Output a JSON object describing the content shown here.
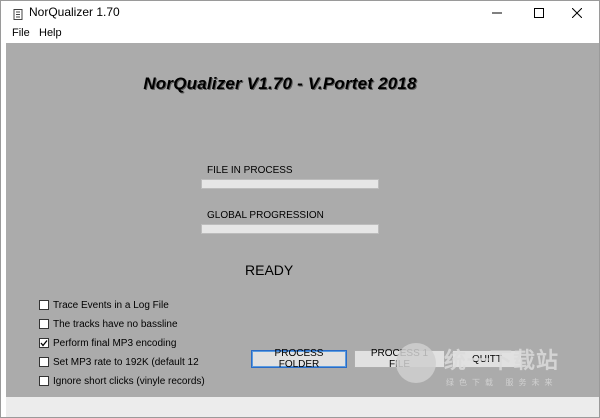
{
  "window": {
    "title": "NorQualizer 1.70"
  },
  "menu": {
    "file": "File",
    "help": "Help"
  },
  "main": {
    "heading": "NorQualizer V1.70 - V.Portet 2018",
    "file_in_process_label": "FILE IN PROCESS",
    "file_progress": 0,
    "global_progression_label": "GLOBAL PROGRESSION",
    "global_progress": 0,
    "status": "READY"
  },
  "options": [
    {
      "label": "Trace Events in a Log File",
      "checked": false
    },
    {
      "label": "The tracks have no bassline",
      "checked": false
    },
    {
      "label": "Perform final MP3 encoding",
      "checked": true
    },
    {
      "label": "Set MP3 rate to 192K (default 12",
      "checked": false
    },
    {
      "label": "Ignore short clicks (vinyle records)",
      "checked": false
    }
  ],
  "buttons": {
    "process_folder": "PROCESS FOLDER",
    "process_file": "PROCESS 1 FILE",
    "quit": "QUITT"
  },
  "watermark": {
    "text": "统一下载站",
    "subtext": "绿色下载 服务未来"
  },
  "colors": {
    "client_bg": "#ababab",
    "progress_bg": "#e6e6e6",
    "focus_border": "#2a6cc7"
  }
}
